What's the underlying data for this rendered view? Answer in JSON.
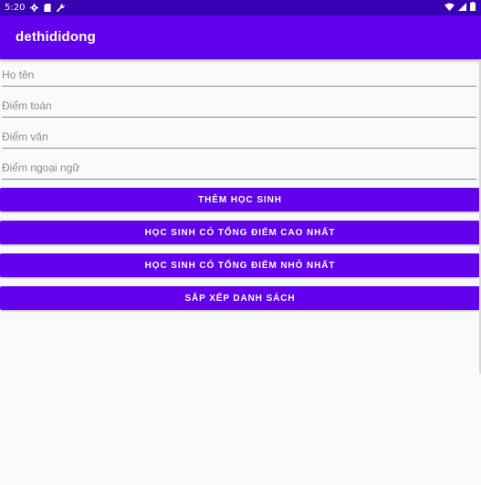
{
  "status_bar": {
    "time": "5:20",
    "icons": [
      "settings-gear-icon",
      "sim-card-icon",
      "wrench-icon",
      "wifi-icon",
      "signal-icon",
      "battery-icon"
    ]
  },
  "app_bar": {
    "title": "dethididong",
    "color": "#6200ee"
  },
  "form": {
    "name_placeholder": "Họ tên",
    "math_placeholder": "Điểm toán",
    "literature_placeholder": "Điểm văn",
    "language_placeholder": "Điểm ngoại ngữ"
  },
  "buttons": {
    "add_student": "THÊM HỌC SINH",
    "highest_total": "HỌC SINH CÓ TỔNG ĐIỂM CAO NHẤT",
    "lowest_total": "HỌC SINH CÓ TỔNG ĐIỂM NHỎ NHẤT",
    "sort_list": "SẮP XẾP DANH SÁCH"
  },
  "colors": {
    "primary": "#6200ee",
    "primary_dark": "#3700b3",
    "background": "#fafafa"
  }
}
